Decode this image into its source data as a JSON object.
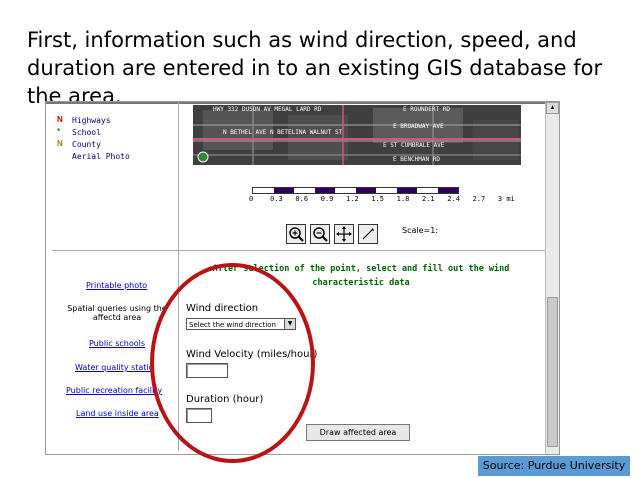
{
  "slide": {
    "title": "First, information such as wind direction, speed, and duration are entered in to an existing GIS database for the area."
  },
  "legend": {
    "items": [
      {
        "label": "Highways",
        "mark": "N",
        "color": "#cc0000"
      },
      {
        "label": "School",
        "mark": "*",
        "color": "#00aa00"
      },
      {
        "label": "County",
        "mark": "N",
        "color": "#aa7700"
      },
      {
        "label": "Aerial Photo",
        "mark": "",
        "color": "#000000"
      }
    ]
  },
  "map": {
    "streets": [
      "HWY 332 DUSON AV MEGAL LARD RD",
      "E ROUNDERT RD",
      "N BETHEL AVE  N BETELINA  WALNUT ST",
      "E BROADWAY AVE",
      "E ST CUMBRALE AVE",
      "E BENCHMAN RD"
    ],
    "scale_labels": [
      "0",
      "0.3",
      "0.6",
      "0.9",
      "1.2",
      "1.5",
      "1.8",
      "2.1",
      "2.4",
      "2.7",
      "3 mi"
    ],
    "scale_text": "Scale=1:"
  },
  "toolbar": {
    "zoom_in_icon": "zoom-in-icon",
    "zoom_out_icon": "zoom-out-icon",
    "pan_icon": "pan-icon",
    "select_icon": "select-point-icon"
  },
  "sidebar": {
    "printable_photo": "Printable photo",
    "spatial_queries": "Spatial queries using the affectd area",
    "public_schools": "Public schools",
    "water_quality": "Water quality statio",
    "public_recreation": "Public recreation facility",
    "land_use": "Land use inside area"
  },
  "form": {
    "instruction": "After selection of the point, select and fill out the wind characteristic data",
    "wind_direction_label": "Wind direction",
    "wind_direction_value": "Select the wind direction",
    "wind_velocity_label": "Wind Velocity (miles/hour)",
    "wind_velocity_value": "",
    "duration_label": "Duration (hour)",
    "duration_value": "",
    "submit_label": "Draw affected area"
  },
  "source": {
    "text": "Source: Purdue University"
  },
  "colors": {
    "highlight_circle": "#b81414",
    "instruction_text": "#006400",
    "link": "#0000cc",
    "source_box": "#5b9bd5"
  }
}
